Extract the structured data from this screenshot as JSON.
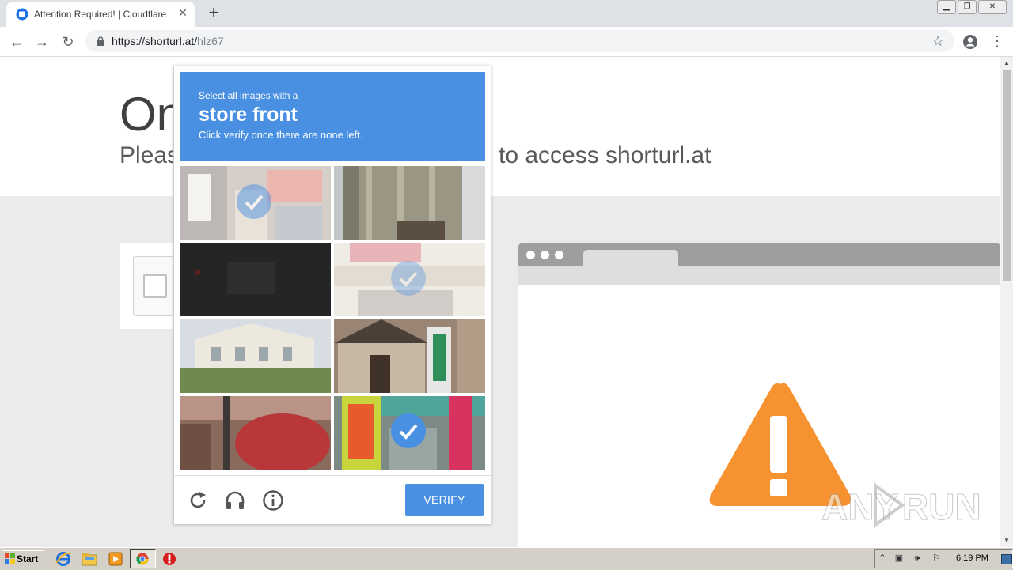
{
  "browser": {
    "tab_title": "Attention Required! | Cloudflare",
    "url_host": "https://shorturl.at/",
    "url_path": "hlz67",
    "window_buttons": [
      "minimize",
      "restore",
      "close"
    ]
  },
  "page": {
    "title_visible": "On",
    "subtitle_left": "Pleas",
    "subtitle_right": "to access shorturl.at"
  },
  "challenge": {
    "instruction_line1": "Select all images with a",
    "target": "store front",
    "instruction_line3": "Click verify once there are none left.",
    "tiles": [
      {
        "name": "tile-1",
        "selected": true
      },
      {
        "name": "tile-2",
        "selected": false
      },
      {
        "name": "tile-3",
        "selected": false
      },
      {
        "name": "tile-4",
        "selected": true
      },
      {
        "name": "tile-5",
        "selected": false
      },
      {
        "name": "tile-6",
        "selected": false
      },
      {
        "name": "tile-7",
        "selected": false
      },
      {
        "name": "tile-8",
        "selected": true
      }
    ],
    "footer_icons": [
      "reload-icon",
      "audio-icon",
      "info-icon"
    ],
    "verify_label": "VERIFY"
  },
  "watermark": {
    "left": "ANY",
    "right": "RUN"
  },
  "taskbar": {
    "start_label": "Start",
    "apps": [
      "ie-icon",
      "explorer-icon",
      "media-player-icon",
      "chrome-icon",
      "stop-icon"
    ],
    "clock": "6:19 PM"
  },
  "colors": {
    "challenge_blue": "#4a90e2",
    "warning_orange": "#f6922f"
  }
}
